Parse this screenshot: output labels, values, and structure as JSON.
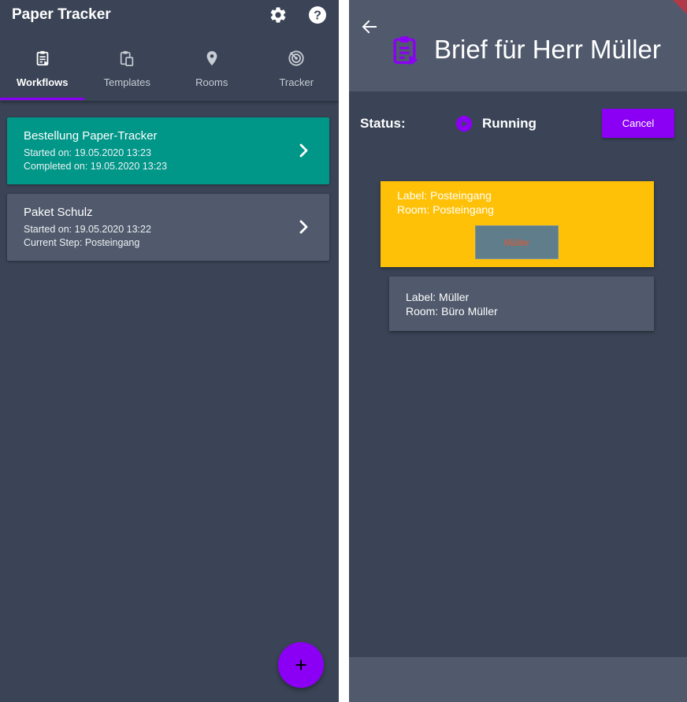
{
  "left": {
    "app_title": "Paper Tracker",
    "actions": [
      {
        "name": "settings",
        "icon": "gear-icon"
      },
      {
        "name": "help",
        "icon": "help-icon"
      }
    ],
    "tabs": [
      {
        "label": "Workflows",
        "icon": "clipboard-icon",
        "active": true
      },
      {
        "label": "Templates",
        "icon": "clipboard-copy-icon",
        "active": false
      },
      {
        "label": "Rooms",
        "icon": "location-pin-icon",
        "active": false
      },
      {
        "label": "Tracker",
        "icon": "radar-icon",
        "active": false
      }
    ],
    "cards": [
      {
        "title": "Bestellung Paper-Tracker",
        "line1": "Started on: 19.05.2020 13:23",
        "line2": "Completed on: 19.05.2020 13:23",
        "color": "#009688"
      },
      {
        "title": "Paket Schulz",
        "line1": "Started on: 19.05.2020 13:22",
        "line2": "Current Step: Posteingang",
        "color": "#505a6c"
      }
    ],
    "fab_icon": "plus-icon"
  },
  "right": {
    "title": "Brief für Herr Müller",
    "status_label": "Status:",
    "status_value": "Running",
    "cancel_label": "Cancel",
    "steps": [
      {
        "label": "Label: Posteingang",
        "room": "Room: Posteingang",
        "chip": "Müller",
        "color": "#ffc107"
      },
      {
        "label": "Label: Müller",
        "room": "Room: Büro Müller",
        "color": "#505a6c"
      }
    ]
  },
  "colors": {
    "background": "#3a4456",
    "accent": "#8b00f5",
    "completed": "#009688",
    "active_step": "#ffc107"
  }
}
